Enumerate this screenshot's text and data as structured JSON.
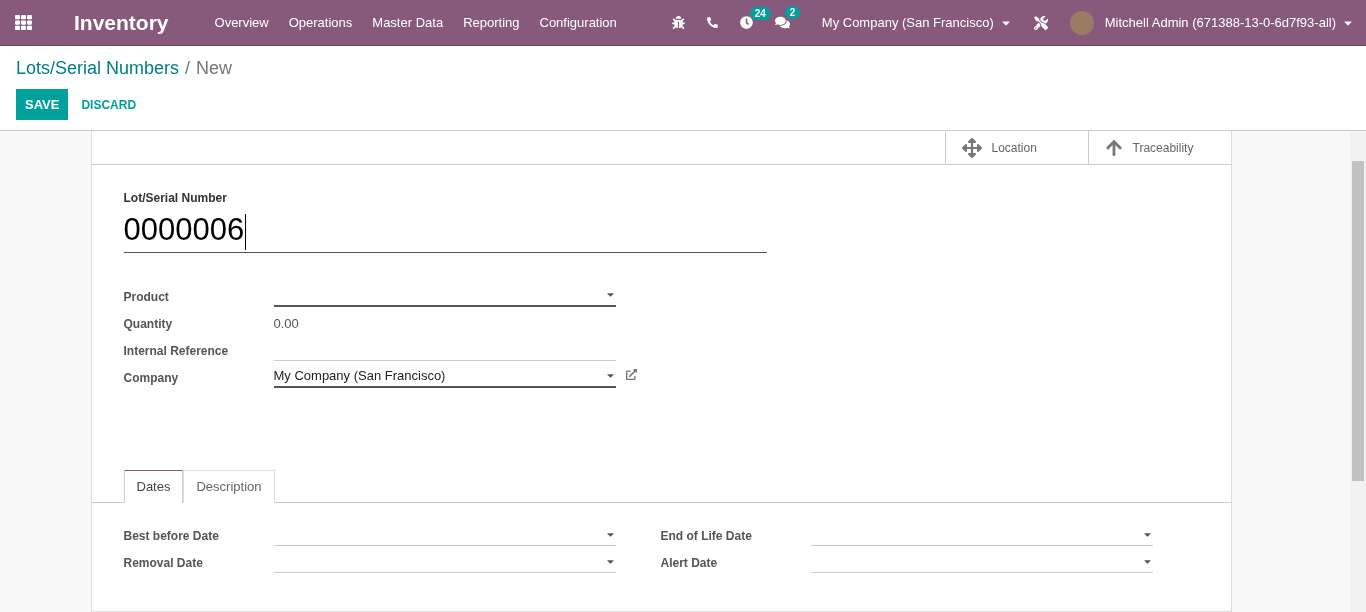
{
  "navbar": {
    "app_name": "Inventory",
    "menu": [
      "Overview",
      "Operations",
      "Master Data",
      "Reporting",
      "Configuration"
    ],
    "activity_count": "24",
    "message_count": "2",
    "company": "My Company (San Francisco)",
    "user": "Mitchell Admin (671388-13-0-6d7f93-all)"
  },
  "breadcrumb": {
    "parent": "Lots/Serial Numbers",
    "separator": "/",
    "current": "New"
  },
  "buttons": {
    "save": "SAVE",
    "discard": "DISCARD"
  },
  "smart_buttons": [
    {
      "kind": "location",
      "label": "Location"
    },
    {
      "kind": "traceability",
      "label": "Traceability"
    }
  ],
  "title_field": {
    "label": "Lot/Serial Number",
    "value": "0000006"
  },
  "fields": [
    {
      "label": "Product",
      "kind": "dropdown",
      "required": true
    },
    {
      "label": "Quantity",
      "kind": "readonly",
      "value": "0.00"
    },
    {
      "label": "Internal Reference",
      "kind": "text",
      "required": false
    },
    {
      "label": "Company",
      "kind": "dropdown",
      "value": "My Company (San Francisco)",
      "required": true,
      "external_link": true
    }
  ],
  "tabs": [
    {
      "label": "Dates",
      "selected": true
    },
    {
      "label": "Description",
      "selected": false
    }
  ],
  "date_fields": [
    {
      "label": "Best before Date"
    },
    {
      "label": "End of Life Date"
    },
    {
      "label": "Removal Date"
    },
    {
      "label": "Alert Date"
    }
  ]
}
